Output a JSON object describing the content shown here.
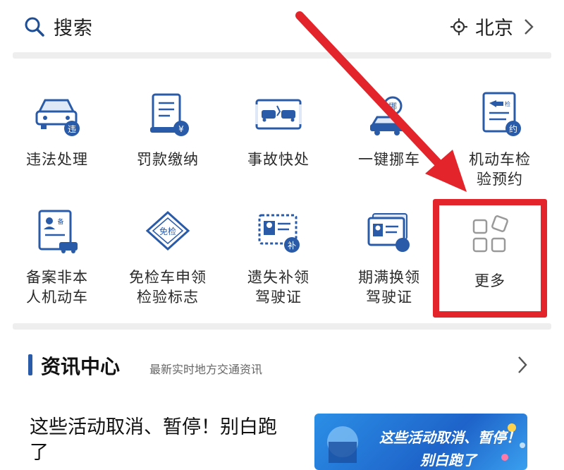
{
  "search": {
    "label": "搜索",
    "location": "北京"
  },
  "services": [
    {
      "label": "违法处理",
      "icon": "car-violation-icon"
    },
    {
      "label": "罚款缴纳",
      "icon": "fine-scroll-icon"
    },
    {
      "label": "事故快处",
      "icon": "accident-cars-icon"
    },
    {
      "label": "一键挪车",
      "icon": "move-car-icon"
    },
    {
      "label": "机动车检\n验预约",
      "icon": "inspection-appointment-icon"
    },
    {
      "label": "备案非本\n人机动车",
      "icon": "register-vehicle-icon"
    },
    {
      "label": "免检车申领\n检验标志",
      "icon": "exempt-label-icon"
    },
    {
      "label": "遗失补领\n驾驶证",
      "icon": "lost-license-icon"
    },
    {
      "label": "期满换领\n驾驶证",
      "icon": "renew-license-icon"
    },
    {
      "label": "更多",
      "icon": "more-grid-icon"
    }
  ],
  "news": {
    "title": "资讯中心",
    "subtitle": "最新实时地方交通资讯",
    "items": [
      {
        "title": "这些活动取消、暂停！别白跑了",
        "thumb_text": "这些活动取消、暂停！",
        "thumb_text2": "别白跑了"
      }
    ]
  },
  "colors": {
    "accent_blue": "#2a5ba8",
    "highlight_red": "#e3242b",
    "separator": "#eeeeee"
  }
}
